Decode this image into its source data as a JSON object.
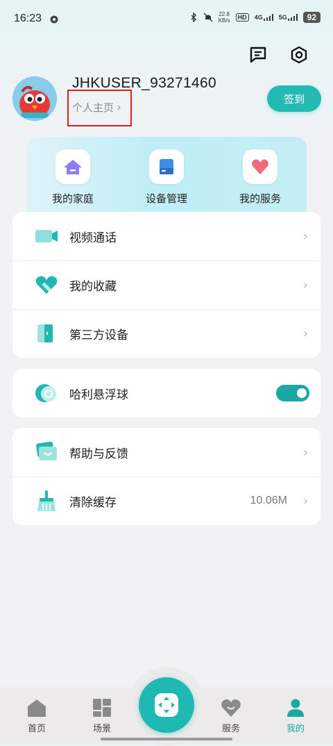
{
  "status": {
    "time": "16:23",
    "speed_top": "22.8",
    "speed_unit": "KB/s",
    "hd": "HD",
    "net1": "4G",
    "net2": "5G",
    "battery": "92"
  },
  "header": {
    "message_icon": "message-square-icon",
    "settings_icon": "settings-hexagon-icon"
  },
  "user": {
    "name": "JHKUSER_93271460",
    "profile_link": "个人主页",
    "checkin_label": "签到"
  },
  "quick": [
    {
      "label": "我的家庭",
      "icon": "home-icon"
    },
    {
      "label": "设备管理",
      "icon": "device-icon"
    },
    {
      "label": "我的服务",
      "icon": "heart-icon"
    }
  ],
  "menu1": [
    {
      "label": "视频通话",
      "icon": "video-call-icon"
    },
    {
      "label": "我的收藏",
      "icon": "favorite-heart-icon"
    },
    {
      "label": "第三方设备",
      "icon": "third-party-device-icon"
    }
  ],
  "menu2": [
    {
      "label": "哈利悬浮球",
      "icon": "floating-ball-icon",
      "toggle": true
    }
  ],
  "menu3": [
    {
      "label": "帮助与反馈",
      "icon": "help-feedback-icon"
    },
    {
      "label": "清除缓存",
      "icon": "broom-icon",
      "value": "10.06M"
    }
  ],
  "tabs": [
    {
      "label": "首页",
      "icon": "home-tab-icon",
      "active": false
    },
    {
      "label": "场景",
      "icon": "scene-tab-icon",
      "active": false
    },
    {
      "label": "服务",
      "icon": "service-tab-icon",
      "active": false
    },
    {
      "label": "我的",
      "icon": "profile-tab-icon",
      "active": true
    }
  ],
  "colors": {
    "accent": "#25b9b3",
    "highlight_box": "#e01b1b",
    "active_tab": "#1aa8a2"
  }
}
